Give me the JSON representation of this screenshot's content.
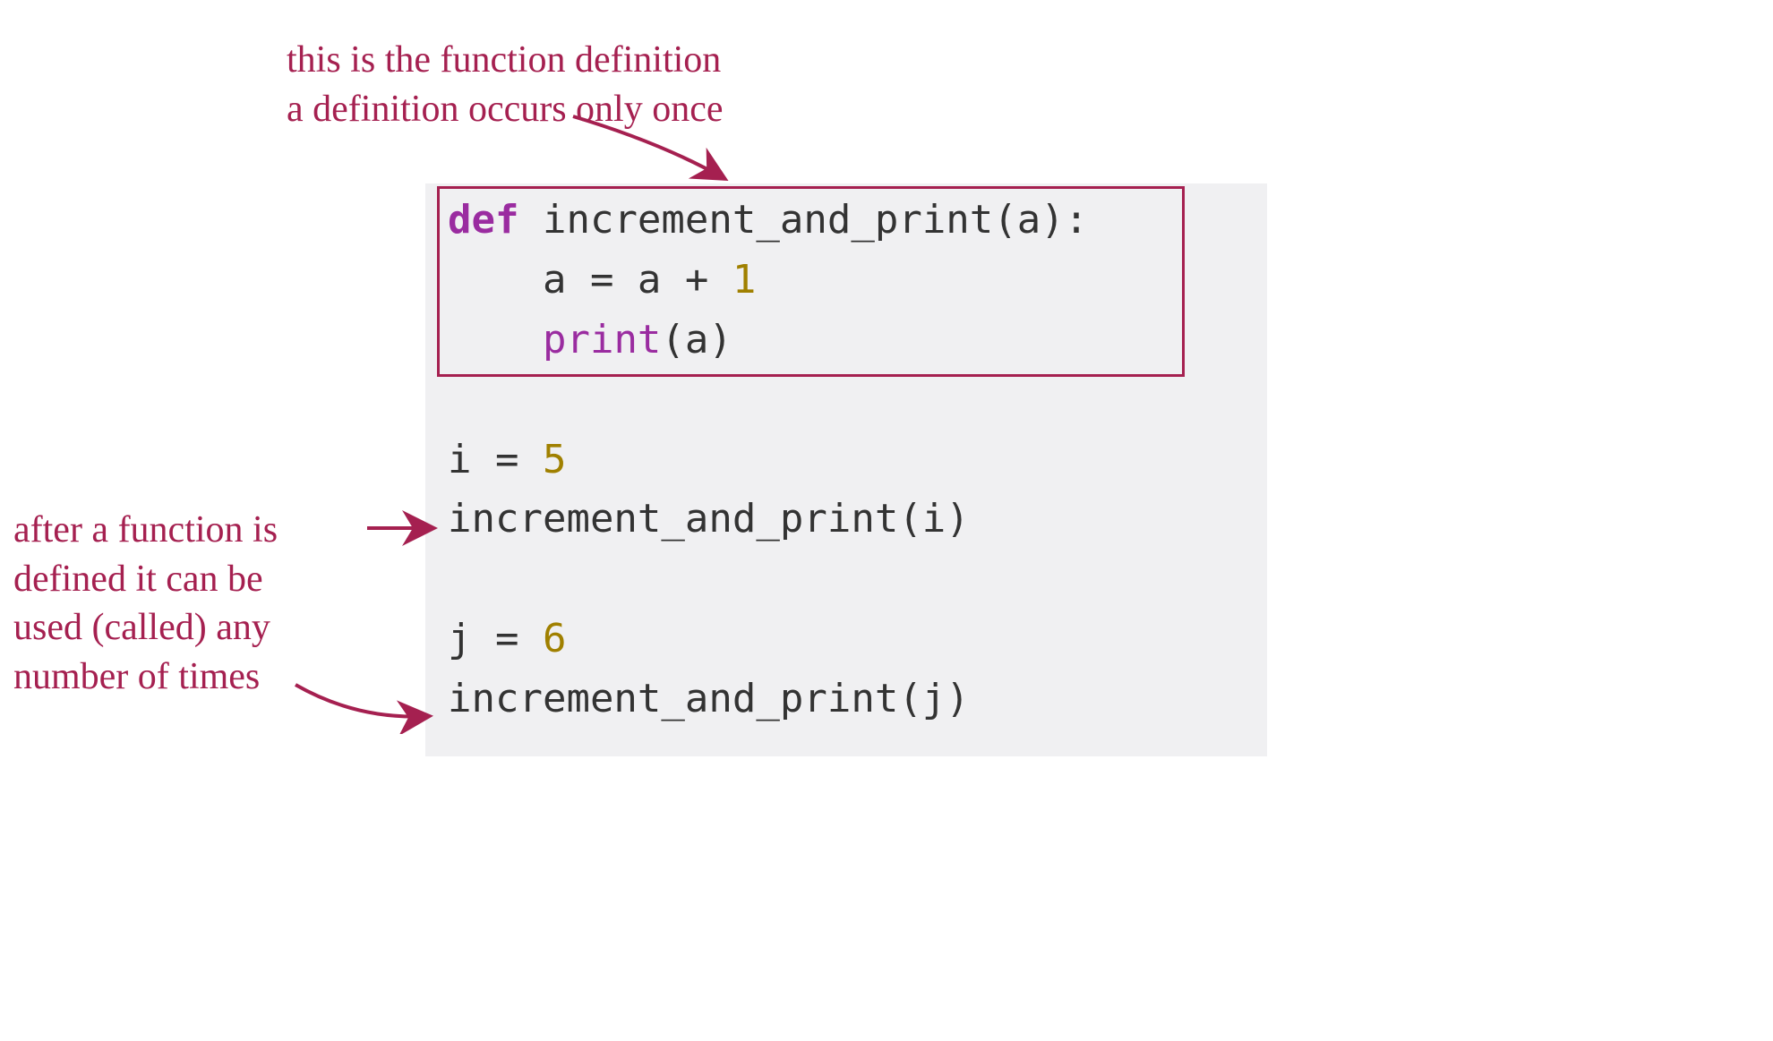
{
  "annotations": {
    "top_line1": "this is the function definition",
    "top_line2": "a definition occurs only once",
    "left_line1": "after a function is",
    "left_line2": "defined it can be",
    "left_line3": "used (called) any",
    "left_line4": "number of times"
  },
  "code": {
    "def_keyword": "def",
    "func_name": " increment_and_print(a):",
    "body_line1_pre": "    a = a + ",
    "body_line1_num": "1",
    "body_line2_indent": "    ",
    "body_line2_print": "print",
    "body_line2_rest": "(a)",
    "i_assign_pre": "i = ",
    "i_assign_num": "5",
    "call_i": "increment_and_print(i)",
    "j_assign_pre": "j = ",
    "j_assign_num": "6",
    "call_j": "increment_and_print(j)"
  }
}
